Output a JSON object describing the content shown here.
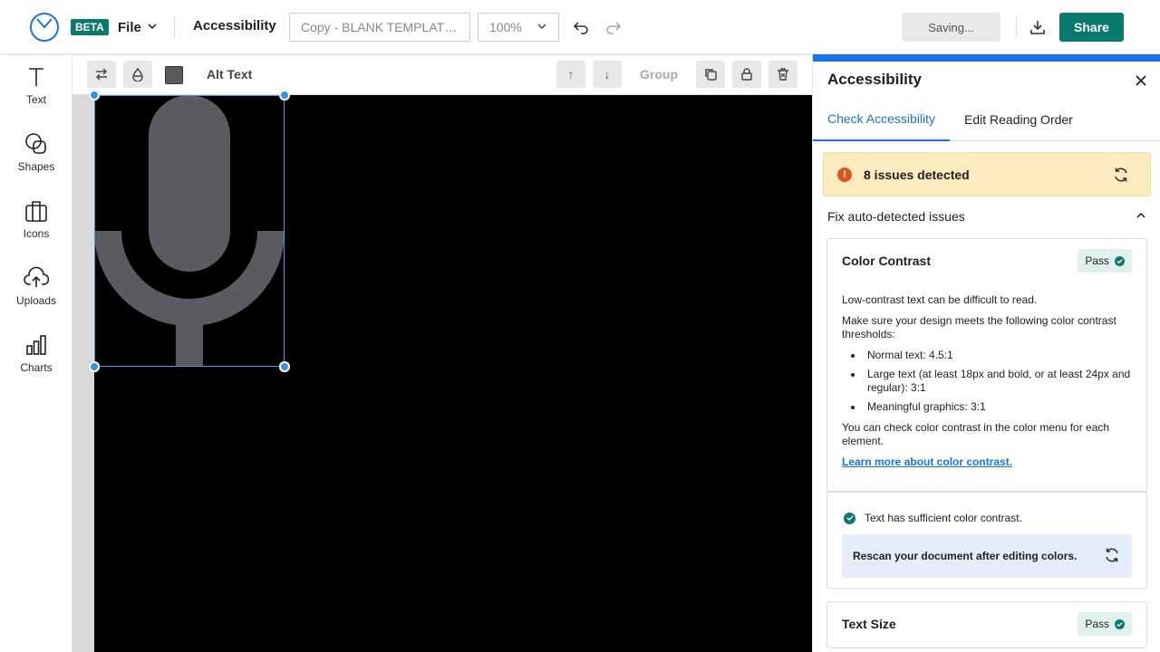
{
  "header": {
    "beta_label": "BETA",
    "file_label": "File",
    "section_title": "Accessibility",
    "doc_name_value": "Copy - BLANK TEMPLAT…",
    "zoom_value": "100%",
    "saving_label": "Saving...",
    "share_label": "Share"
  },
  "sidebar": {
    "items": [
      {
        "label": "Text",
        "icon": "text-icon"
      },
      {
        "label": "Shapes",
        "icon": "shapes-icon"
      },
      {
        "label": "Icons",
        "icon": "icons-icon"
      },
      {
        "label": "Uploads",
        "icon": "upload-icon"
      },
      {
        "label": "Charts",
        "icon": "charts-icon"
      }
    ]
  },
  "context_toolbar": {
    "alt_text_label": "Alt Text",
    "group_label": "Group",
    "up_label": "↑",
    "down_label": "↓",
    "swatch_color": "#5a5a60"
  },
  "panel": {
    "title": "Accessibility",
    "tabs": [
      {
        "label": "Check Accessibility",
        "active": true
      },
      {
        "label": "Edit Reading Order",
        "active": false
      }
    ],
    "issues_text": "8 issues detected",
    "fix_label": "Fix auto-detected issues",
    "color_contrast": {
      "title": "Color Contrast",
      "status": "Pass",
      "intro": "Low-contrast text can be difficult to read.",
      "make_sure": "Make sure your design meets the following color contrast thresholds:",
      "thresholds": [
        "Normal text: 4.5:1",
        "Large text (at least 18px and bold, or at least 24px and regular): 3:1",
        "Meaningful graphics: 3:1"
      ],
      "check_hint": "You can check color contrast in the color menu for each element.",
      "learn_more": "Learn more about color contrast.",
      "ok_text": "Text has sufficient color contrast.",
      "rescan_text": "Rescan your document after editing colors."
    },
    "text_size": {
      "title": "Text Size",
      "status": "Pass"
    }
  },
  "colors": {
    "brand_teal": "#0a7a6e",
    "accent_blue": "#1a73e8",
    "warning_bg": "#fdebc0",
    "mic_gray": "#5a5a60"
  }
}
